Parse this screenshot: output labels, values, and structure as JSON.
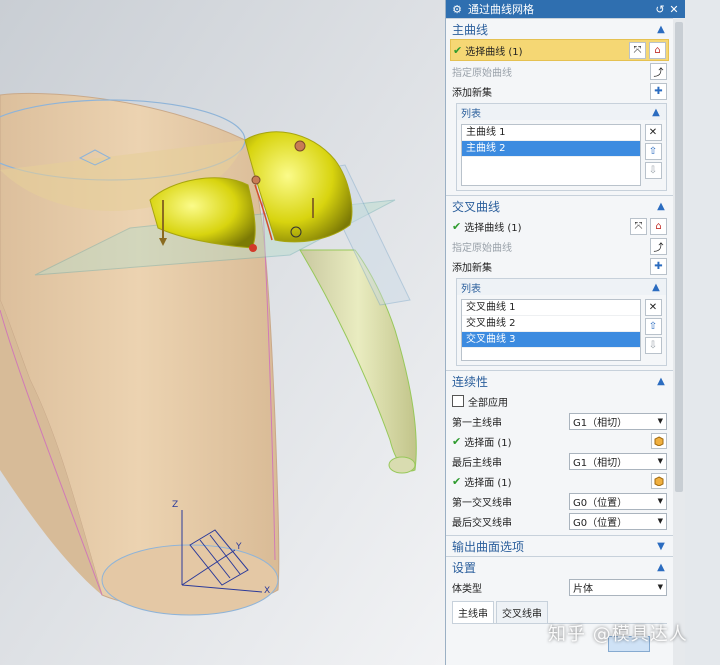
{
  "dialog": {
    "title": "通过曲线网格",
    "primary": {
      "header": "主曲线",
      "select_label": "选择曲线 (1)",
      "specify_origin": "指定原始曲线",
      "add_new_set": "添加新集",
      "list_header": "列表",
      "items": [
        "主曲线 1",
        "主曲线 2"
      ],
      "selected_index": 1
    },
    "cross": {
      "header": "交叉曲线",
      "select_label": "选择曲线 (1)",
      "specify_origin": "指定原始曲线",
      "add_new_set": "添加新集",
      "list_header": "列表",
      "items": [
        "交叉曲线 1",
        "交叉曲线 2",
        "交叉曲线 3"
      ],
      "selected_index": 2
    },
    "continuity": {
      "header": "连续性",
      "apply_all": "全部应用",
      "first_primary_label": "第一主线串",
      "first_primary_value": "G1（相切）",
      "select_face_1": "选择面 (1)",
      "last_primary_label": "最后主线串",
      "last_primary_value": "G1（相切）",
      "select_face_2": "选择面 (1)",
      "first_cross_label": "第一交叉线串",
      "first_cross_value": "G0（位置）",
      "last_cross_label": "最后交叉线串",
      "last_cross_value": "G0（位置）"
    },
    "output": {
      "header": "输出曲面选项"
    },
    "settings": {
      "header": "设置",
      "body_type_label": "体类型",
      "body_type_value": "片体",
      "tabs": [
        "主线串",
        "交叉线串"
      ]
    }
  },
  "viewport": {
    "axis_labels": {
      "z": "Z",
      "y": "Y",
      "x": "X"
    }
  },
  "watermark": "知乎 @模具达人",
  "colors": {
    "title_bar": "#2f6fb0",
    "section_header_text": "#2b5f9c",
    "selected_row": "#f5d774",
    "list_selection": "#3c8be0",
    "surface_yellow": "#e3e22a",
    "body_beige": "#e8c9a2"
  }
}
